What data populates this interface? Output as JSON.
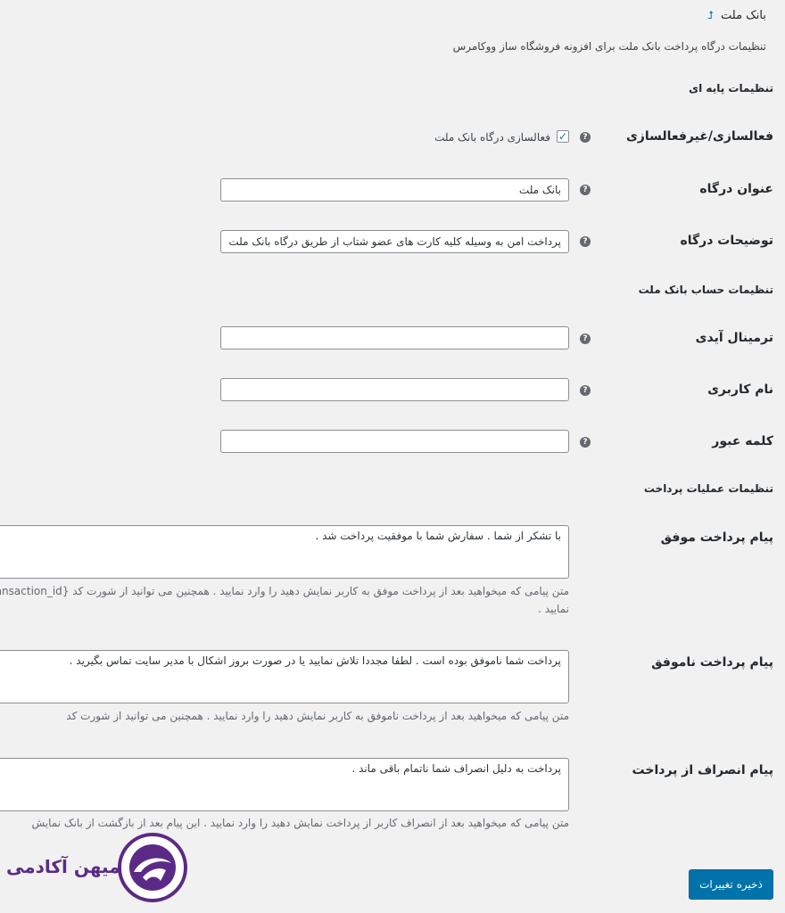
{
  "page": {
    "title": "بانک ملت",
    "back_link": "⮥",
    "description": "تنظیمات درگاه پرداخت بانک ملت برای افزونه فروشگاه ساز ووکامرس"
  },
  "sections": {
    "basic": "تنظیمات پایه ای",
    "account": "تنظیمات حساب بانک ملت",
    "payment": "تنظیمات عملیات پرداخت"
  },
  "fields": {
    "enable": {
      "label": "فعالسازی/غیرفعالسازی",
      "checkbox_label": "فعالسازی درگاه بانک ملت",
      "checked": true
    },
    "title": {
      "label": "عنوان درگاه",
      "value": "بانک ملت"
    },
    "description": {
      "label": "توضیحات درگاه",
      "value": "پرداخت امن به وسیله کلیه کارت های عضو شتاب از طریق درگاه بانک ملت"
    },
    "terminal": {
      "label": "ترمینال آیدی",
      "value": ""
    },
    "username": {
      "label": "نام کاربری",
      "value": ""
    },
    "password": {
      "label": "کلمه عبور",
      "value": ""
    },
    "success": {
      "label": "پیام پرداخت موفق",
      "value": "با تشکر از شما . سفارش شما با موفقیت پرداخت شد .",
      "hint1": "متن پیامی که میخواهید بعد از پرداخت موفق به کاربر نمایش دهید را وارد نمایید . همچنین می توانید از شورت کد {transaction_id}",
      "hint2": "نمایید ."
    },
    "failed": {
      "label": "پیام پرداخت ناموفق",
      "value": "پرداخت شما ناموفق بوده است . لطفا مجددا تلاش نمایید یا در صورت بروز اشکال با مدیر سایت تماس بگیرید .",
      "hint1": "متن پیامی که میخواهید بعد از پرداخت ناموفق به کاربر نمایش دهید را وارد نمایید . همچنین می توانید از شورت کد"
    },
    "cancel": {
      "label": "پیام انصراف از پرداخت",
      "value": "پرداخت به دلیل انصراف شما ناتمام باقی ماند .",
      "hint1": "متن پیامی که میخواهید بعد از انصراف کاربر از پرداخت نمایش دهید را وارد نمایید . این پیام بعد از بازگشت از بانک نمایش"
    }
  },
  "help_glyph": "?",
  "save_button": "ذخیره تغییرات",
  "logo": {
    "text": "میهن آکادمی",
    "icon": "mihan-academy-logo-icon"
  },
  "colors": {
    "accent": "#0073aa",
    "logo": "#5b2a86"
  }
}
